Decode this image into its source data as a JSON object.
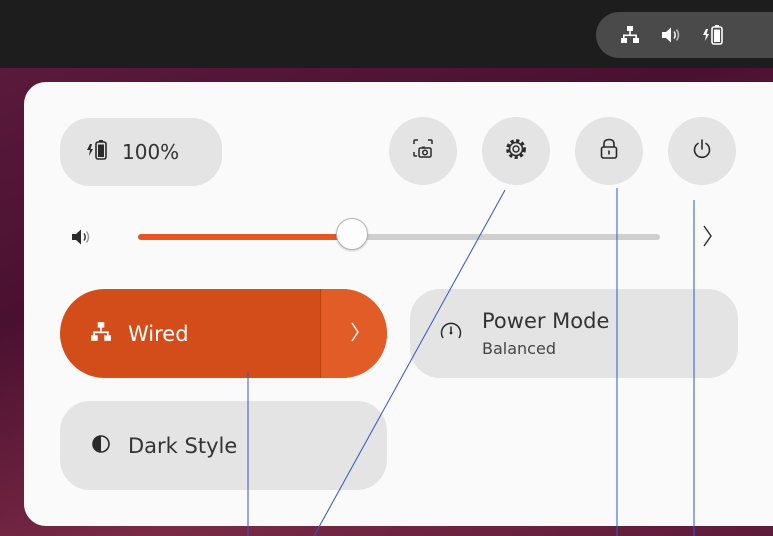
{
  "colors": {
    "accent": "#e95420",
    "wired_active": "#d34d1b",
    "panel_bg": "#fafafa",
    "pill_bg": "#e4e4e4",
    "topbar": "#1d1d1d"
  },
  "tray": {
    "icons": [
      "network-wired-icon",
      "volume-icon",
      "battery-charging-icon"
    ]
  },
  "battery": {
    "icon": "battery-charging-icon",
    "label": "100%"
  },
  "actions": [
    {
      "name": "screenshot-button",
      "icon": "screenshot-icon"
    },
    {
      "name": "settings-button",
      "icon": "gear-icon"
    },
    {
      "name": "lock-button",
      "icon": "lock-icon"
    },
    {
      "name": "power-button",
      "icon": "power-icon"
    }
  ],
  "volume": {
    "icon": "volume-icon",
    "level": 0.41
  },
  "toggles": {
    "wired": {
      "label": "Wired",
      "icon": "network-wired-icon",
      "active": true
    },
    "power_mode": {
      "title": "Power Mode",
      "subtitle": "Balanced",
      "icon": "speedometer-icon"
    },
    "dark_style": {
      "label": "Dark Style",
      "icon": "contrast-icon"
    }
  }
}
